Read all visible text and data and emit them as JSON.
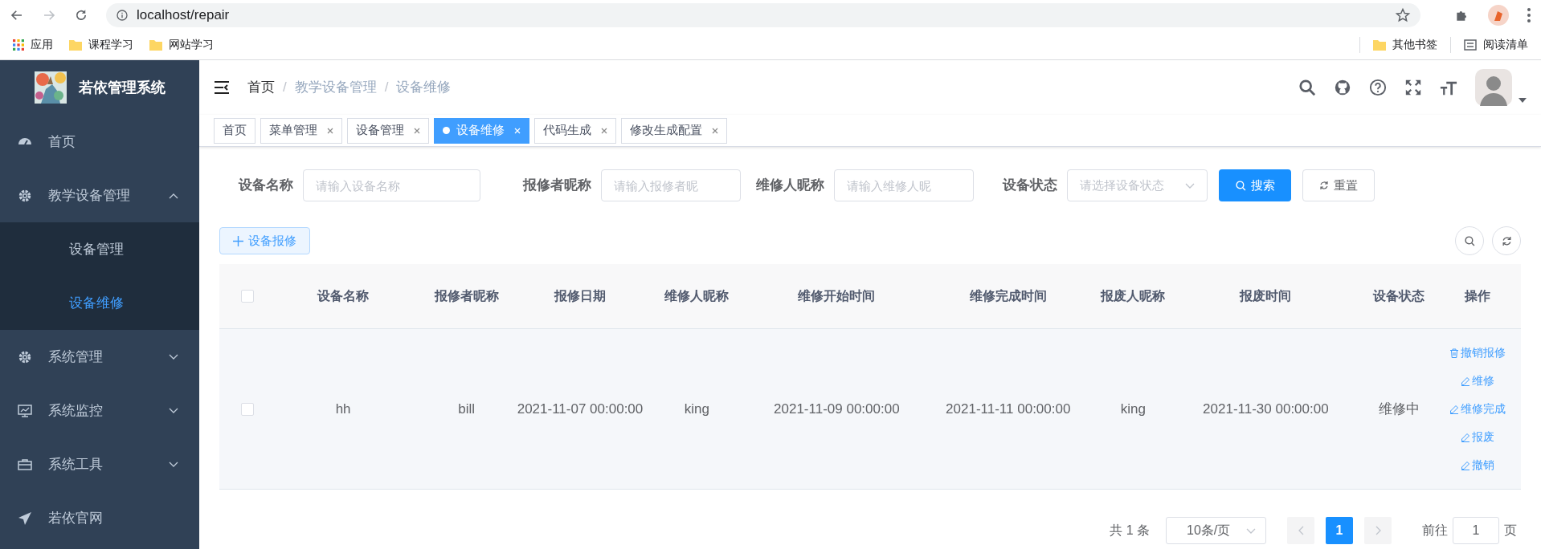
{
  "browser": {
    "url": "localhost/repair",
    "bookmarks": [
      {
        "label": "应用",
        "kind": "apps"
      },
      {
        "label": "课程学习",
        "kind": "folder"
      },
      {
        "label": "网站学习",
        "kind": "folder"
      }
    ],
    "bookmarks_right": [
      {
        "label": "其他书签",
        "kind": "folder"
      },
      {
        "label": "阅读清单",
        "kind": "reading_list"
      }
    ]
  },
  "sidebar": {
    "title": "若依管理系统",
    "items": [
      {
        "label": "首页",
        "selected": false
      },
      {
        "label": "教学设备管理",
        "selected": false,
        "expanded": true,
        "children": [
          {
            "label": "设备管理",
            "selected": false
          },
          {
            "label": "设备维修",
            "selected": true
          }
        ]
      },
      {
        "label": "系统管理",
        "selected": false,
        "expanded": false
      },
      {
        "label": "系统监控",
        "selected": false,
        "expanded": false
      },
      {
        "label": "系统工具",
        "selected": false,
        "expanded": false
      },
      {
        "label": "若依官网",
        "selected": false
      }
    ]
  },
  "breadcrumb_separator": "/",
  "breadcrumb": [
    {
      "label": "首页",
      "link": true
    },
    {
      "label": "教学设备管理",
      "link": false
    },
    {
      "label": "设备维修",
      "link": false
    }
  ],
  "tags": [
    {
      "label": "首页",
      "selected": false,
      "closable": false
    },
    {
      "label": "菜单管理",
      "selected": false,
      "closable": true
    },
    {
      "label": "设备管理",
      "selected": false,
      "closable": true
    },
    {
      "label": "设备维修",
      "selected": true,
      "closable": true
    },
    {
      "label": "代码生成",
      "selected": false,
      "closable": true
    },
    {
      "label": "修改生成配置",
      "selected": false,
      "closable": true
    }
  ],
  "filters": [
    {
      "label": "设备名称",
      "kind": "input",
      "placeholder": "请输入设备名称"
    },
    {
      "label": "报修者昵称",
      "kind": "input",
      "placeholder": "请输入报修者昵"
    },
    {
      "label": "维修人昵称",
      "kind": "input",
      "placeholder": "请输入维修人昵"
    },
    {
      "label": "设备状态",
      "kind": "select",
      "placeholder": "请选择设备状态"
    }
  ],
  "filter_buttons": [
    {
      "label": "搜索",
      "kind": "primary"
    },
    {
      "label": "重置",
      "kind": "default"
    }
  ],
  "add_button": "设备报修",
  "table": {
    "header_checked": false,
    "columns": [
      "设备名称",
      "报修者昵称",
      "报修日期",
      "维修人昵称",
      "维修开始时间",
      "维修完成时间",
      "报废人昵称",
      "报废时间",
      "设备状态",
      "操作"
    ],
    "rows": [
      {
        "checked": false,
        "cells": [
          "hh",
          "bill",
          "2021-11-07 00:00:00",
          "king",
          "2021-11-09 00:00:00",
          "2021-11-11 00:00:00",
          "king",
          "2021-11-30 00:00:00",
          "维修中"
        ],
        "actions": [
          {
            "label": "撤销报修",
            "kind": "delete"
          },
          {
            "label": "维修",
            "kind": "edit"
          },
          {
            "label": "维修完成",
            "kind": "edit"
          },
          {
            "label": "报废",
            "kind": "edit"
          },
          {
            "label": "撤销",
            "kind": "edit"
          }
        ]
      }
    ]
  },
  "pagination": {
    "total": "共 1 条",
    "page_size": "10条/页",
    "pages": [
      {
        "label": "1",
        "selected": true
      }
    ],
    "goto_label": "前往",
    "goto_value": "1",
    "goto_suffix": "页"
  }
}
